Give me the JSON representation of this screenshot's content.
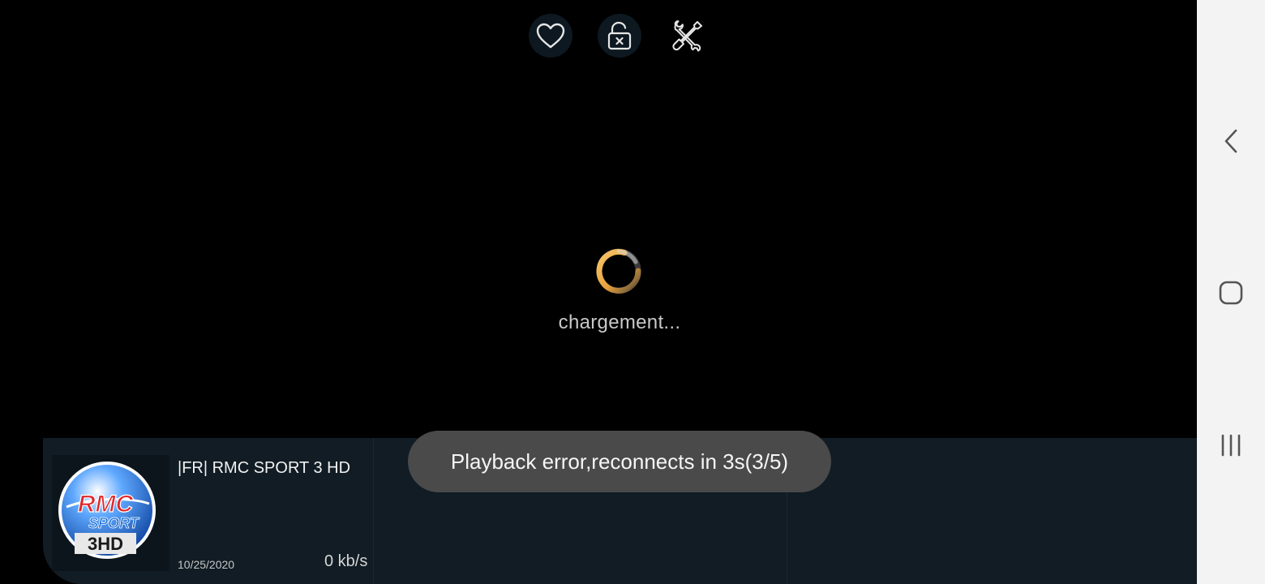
{
  "top_bar": {
    "icons": [
      "heart-icon",
      "unlock-icon",
      "tools-icon"
    ]
  },
  "loading": {
    "text": "chargement..."
  },
  "toast": {
    "text": "Playback error,reconnects in 3s(3/5)"
  },
  "channel": {
    "name": "|FR| RMC SPORT 3 HD",
    "date": "10/25/2020",
    "bitrate": "0 kb/s",
    "logo": {
      "line1": "RMC",
      "line2": "SPORT",
      "badge": "3HD"
    }
  },
  "nav": {
    "icons": [
      "back-icon",
      "home-icon",
      "recents-icon"
    ]
  },
  "colors": {
    "spinner": "#f0b44c",
    "panel": "#111c24",
    "toast": "#4a4a4a",
    "logo_blue": "#1a6fd6",
    "logo_red": "#e2262b"
  }
}
